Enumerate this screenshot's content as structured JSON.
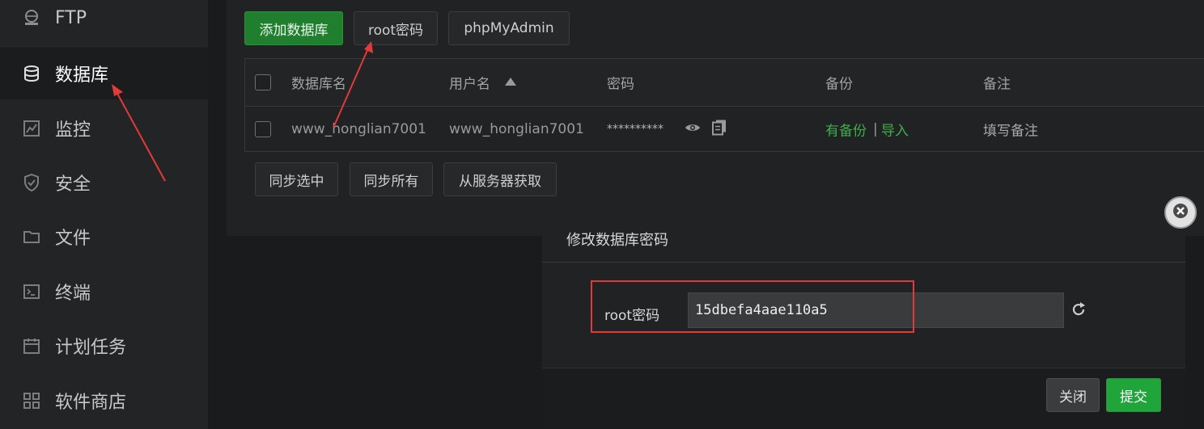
{
  "sidebar": {
    "items": [
      {
        "label": "FTP",
        "icon": "ftp-icon"
      },
      {
        "label": "数据库",
        "icon": "database-icon"
      },
      {
        "label": "监控",
        "icon": "monitor-icon"
      },
      {
        "label": "安全",
        "icon": "shield-icon"
      },
      {
        "label": "文件",
        "icon": "folder-icon"
      },
      {
        "label": "终端",
        "icon": "terminal-icon"
      },
      {
        "label": "计划任务",
        "icon": "calendar-icon"
      },
      {
        "label": "软件商店",
        "icon": "apps-icon"
      }
    ],
    "active": "数据库"
  },
  "toolbar": {
    "add_label": "添加数据库",
    "root_label": "root密码",
    "pma_label": "phpMyAdmin"
  },
  "table": {
    "headers": {
      "name": "数据库名",
      "user": "用户名",
      "password": "密码",
      "backup": "备份",
      "note": "备注"
    },
    "rows": [
      {
        "name": "www_honglian7001",
        "user": "www_honglian7001",
        "password": "**********",
        "backup": "有备份",
        "separator": "|",
        "import": "导入",
        "note": "填写备注"
      }
    ]
  },
  "bulk": {
    "sync_selected": "同步选中",
    "sync_all": "同步所有",
    "fetch_server": "从服务器获取"
  },
  "modal": {
    "title": "修改数据库密码",
    "field_label": "root密码",
    "password_value": "15dbefa4aae110a5",
    "close_label": "关闭",
    "submit_label": "提交"
  },
  "colors": {
    "accent_green": "#20a53a",
    "link_green": "#4caf50",
    "annotation_red": "#e23a3a"
  }
}
